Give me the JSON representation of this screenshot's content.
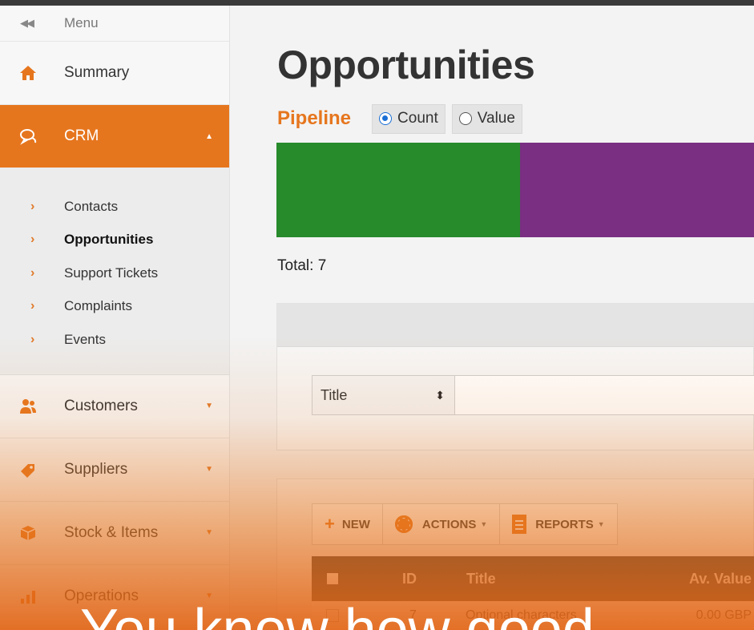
{
  "sidebar": {
    "menu_label": "Menu",
    "collapse_glyph": "◀◀",
    "items": [
      {
        "label": "Summary",
        "icon": "home-icon"
      },
      {
        "label": "CRM",
        "icon": "chat-icon",
        "caret": "▲"
      },
      {
        "label": "Customers",
        "icon": "users-icon",
        "caret": "▼"
      },
      {
        "label": "Suppliers",
        "icon": "tag-icon",
        "caret": "▼"
      },
      {
        "label": "Stock & Items",
        "icon": "box-icon",
        "caret": "▼"
      },
      {
        "label": "Operations",
        "icon": "bar-chart-icon",
        "caret": "▼"
      }
    ],
    "crm_subitems": [
      {
        "label": "Contacts"
      },
      {
        "label": "Opportunities"
      },
      {
        "label": "Support Tickets"
      },
      {
        "label": "Complaints"
      },
      {
        "label": "Events"
      }
    ],
    "accent_color": "#e6761e"
  },
  "main": {
    "title": "Opportunities",
    "pipeline": {
      "label": "Pipeline",
      "options": [
        {
          "label": "Count",
          "selected": true
        },
        {
          "label": "Value",
          "selected": false
        }
      ],
      "segment_colors": [
        "#278a2b",
        "#7a2f82"
      ]
    },
    "total_text": "Total: 7",
    "filter": {
      "field_selected": "Title",
      "value": ""
    },
    "toolbar": {
      "new_label": "NEW",
      "actions_label": "ACTIONS",
      "reports_label": "REPORTS"
    },
    "table": {
      "columns": [
        "ID",
        "Title",
        "Av. Value"
      ],
      "rows": [
        {
          "id": "7",
          "title": "Optional characters",
          "value": "0.00 GBP"
        }
      ]
    }
  },
  "caption": "You know how good"
}
